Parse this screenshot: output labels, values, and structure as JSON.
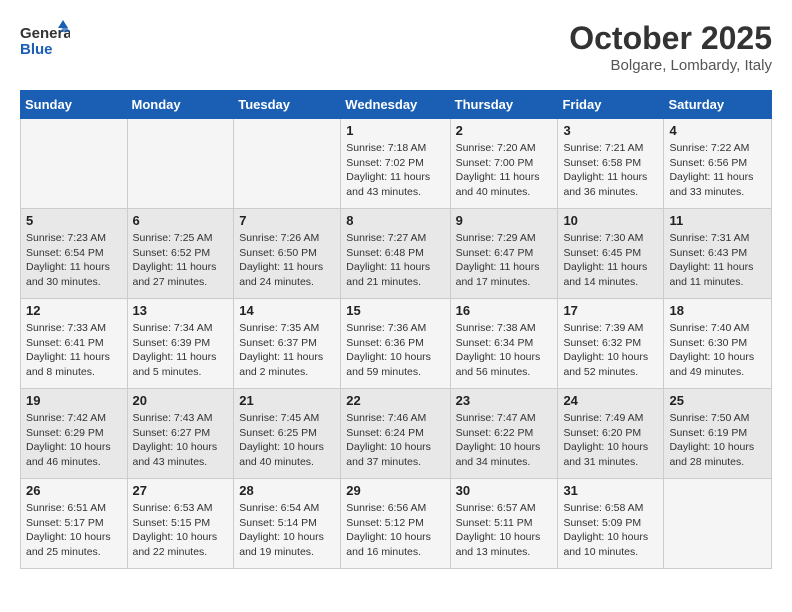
{
  "header": {
    "logo_line1": "General",
    "logo_line2": "Blue",
    "month": "October 2025",
    "location": "Bolgare, Lombardy, Italy"
  },
  "days_of_week": [
    "Sunday",
    "Monday",
    "Tuesday",
    "Wednesday",
    "Thursday",
    "Friday",
    "Saturday"
  ],
  "weeks": [
    [
      {
        "day": "",
        "info": ""
      },
      {
        "day": "",
        "info": ""
      },
      {
        "day": "",
        "info": ""
      },
      {
        "day": "1",
        "info": "Sunrise: 7:18 AM\nSunset: 7:02 PM\nDaylight: 11 hours and 43 minutes."
      },
      {
        "day": "2",
        "info": "Sunrise: 7:20 AM\nSunset: 7:00 PM\nDaylight: 11 hours and 40 minutes."
      },
      {
        "day": "3",
        "info": "Sunrise: 7:21 AM\nSunset: 6:58 PM\nDaylight: 11 hours and 36 minutes."
      },
      {
        "day": "4",
        "info": "Sunrise: 7:22 AM\nSunset: 6:56 PM\nDaylight: 11 hours and 33 minutes."
      }
    ],
    [
      {
        "day": "5",
        "info": "Sunrise: 7:23 AM\nSunset: 6:54 PM\nDaylight: 11 hours and 30 minutes."
      },
      {
        "day": "6",
        "info": "Sunrise: 7:25 AM\nSunset: 6:52 PM\nDaylight: 11 hours and 27 minutes."
      },
      {
        "day": "7",
        "info": "Sunrise: 7:26 AM\nSunset: 6:50 PM\nDaylight: 11 hours and 24 minutes."
      },
      {
        "day": "8",
        "info": "Sunrise: 7:27 AM\nSunset: 6:48 PM\nDaylight: 11 hours and 21 minutes."
      },
      {
        "day": "9",
        "info": "Sunrise: 7:29 AM\nSunset: 6:47 PM\nDaylight: 11 hours and 17 minutes."
      },
      {
        "day": "10",
        "info": "Sunrise: 7:30 AM\nSunset: 6:45 PM\nDaylight: 11 hours and 14 minutes."
      },
      {
        "day": "11",
        "info": "Sunrise: 7:31 AM\nSunset: 6:43 PM\nDaylight: 11 hours and 11 minutes."
      }
    ],
    [
      {
        "day": "12",
        "info": "Sunrise: 7:33 AM\nSunset: 6:41 PM\nDaylight: 11 hours and 8 minutes."
      },
      {
        "day": "13",
        "info": "Sunrise: 7:34 AM\nSunset: 6:39 PM\nDaylight: 11 hours and 5 minutes."
      },
      {
        "day": "14",
        "info": "Sunrise: 7:35 AM\nSunset: 6:37 PM\nDaylight: 11 hours and 2 minutes."
      },
      {
        "day": "15",
        "info": "Sunrise: 7:36 AM\nSunset: 6:36 PM\nDaylight: 10 hours and 59 minutes."
      },
      {
        "day": "16",
        "info": "Sunrise: 7:38 AM\nSunset: 6:34 PM\nDaylight: 10 hours and 56 minutes."
      },
      {
        "day": "17",
        "info": "Sunrise: 7:39 AM\nSunset: 6:32 PM\nDaylight: 10 hours and 52 minutes."
      },
      {
        "day": "18",
        "info": "Sunrise: 7:40 AM\nSunset: 6:30 PM\nDaylight: 10 hours and 49 minutes."
      }
    ],
    [
      {
        "day": "19",
        "info": "Sunrise: 7:42 AM\nSunset: 6:29 PM\nDaylight: 10 hours and 46 minutes."
      },
      {
        "day": "20",
        "info": "Sunrise: 7:43 AM\nSunset: 6:27 PM\nDaylight: 10 hours and 43 minutes."
      },
      {
        "day": "21",
        "info": "Sunrise: 7:45 AM\nSunset: 6:25 PM\nDaylight: 10 hours and 40 minutes."
      },
      {
        "day": "22",
        "info": "Sunrise: 7:46 AM\nSunset: 6:24 PM\nDaylight: 10 hours and 37 minutes."
      },
      {
        "day": "23",
        "info": "Sunrise: 7:47 AM\nSunset: 6:22 PM\nDaylight: 10 hours and 34 minutes."
      },
      {
        "day": "24",
        "info": "Sunrise: 7:49 AM\nSunset: 6:20 PM\nDaylight: 10 hours and 31 minutes."
      },
      {
        "day": "25",
        "info": "Sunrise: 7:50 AM\nSunset: 6:19 PM\nDaylight: 10 hours and 28 minutes."
      }
    ],
    [
      {
        "day": "26",
        "info": "Sunrise: 6:51 AM\nSunset: 5:17 PM\nDaylight: 10 hours and 25 minutes."
      },
      {
        "day": "27",
        "info": "Sunrise: 6:53 AM\nSunset: 5:15 PM\nDaylight: 10 hours and 22 minutes."
      },
      {
        "day": "28",
        "info": "Sunrise: 6:54 AM\nSunset: 5:14 PM\nDaylight: 10 hours and 19 minutes."
      },
      {
        "day": "29",
        "info": "Sunrise: 6:56 AM\nSunset: 5:12 PM\nDaylight: 10 hours and 16 minutes."
      },
      {
        "day": "30",
        "info": "Sunrise: 6:57 AM\nSunset: 5:11 PM\nDaylight: 10 hours and 13 minutes."
      },
      {
        "day": "31",
        "info": "Sunrise: 6:58 AM\nSunset: 5:09 PM\nDaylight: 10 hours and 10 minutes."
      },
      {
        "day": "",
        "info": ""
      }
    ]
  ]
}
